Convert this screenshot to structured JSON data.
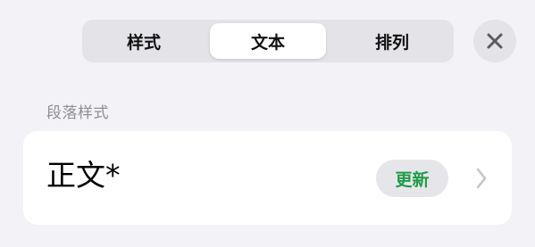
{
  "tabs": [
    {
      "label": "样式",
      "selected": false
    },
    {
      "label": "文本",
      "selected": true
    },
    {
      "label": "排列",
      "selected": false
    }
  ],
  "close_icon": "close-icon",
  "paragraph_style": {
    "header": "段落样式",
    "current_style": "正文*",
    "update_label": "更新",
    "chevron_icon": "chevron-right-icon"
  },
  "colors": {
    "background": "#f2f2f7",
    "segment_track": "#e3e3e8",
    "update_text": "#1f9c47",
    "header_text": "#8e8e93"
  }
}
